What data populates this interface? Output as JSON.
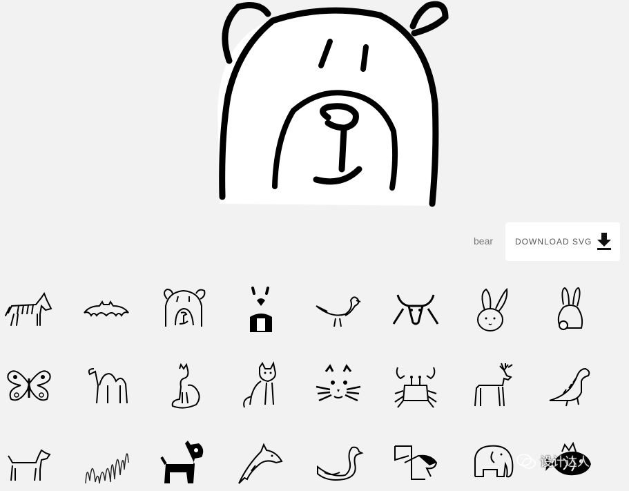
{
  "selected": {
    "name": "bear"
  },
  "download": {
    "label": "DOWNLOAD SVG",
    "icon": "download-icon"
  },
  "watermark": {
    "text": "设计达人",
    "icon": "wechat-icon"
  },
  "gallery": [
    "zebra-icon",
    "bat-icon",
    "bear-icon",
    "bear-heart-icon",
    "bird-icon",
    "bull-icon",
    "bunny-icon",
    "rabbit-back-icon",
    "butterfly-icon",
    "camel-icon",
    "cat-sitting-icon",
    "cat-icon",
    "cat-face-icon",
    "crab-icon",
    "deer-icon",
    "dinosaur-icon",
    "dog-icon",
    "doodle-icon",
    "dog-black-icon",
    "dolphin-icon",
    "duck-icon",
    "eagle-icon",
    "elephant-icon",
    "fish-icon"
  ]
}
